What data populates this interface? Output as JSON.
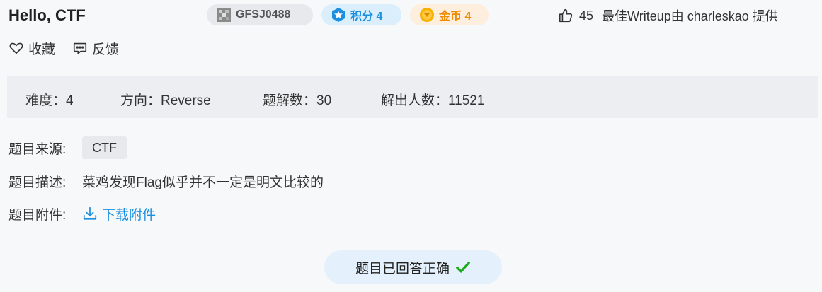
{
  "challenge": {
    "title": "Hello, CTF",
    "code": "GFSJ0488",
    "score_label": "积分 4",
    "coin_label": "金币 4"
  },
  "writeup": {
    "likes": "45",
    "text": "最佳Writeup由 charleskao 提供"
  },
  "actions": {
    "favorite": "收藏",
    "feedback": "反馈"
  },
  "stats": {
    "difficulty": "难度：4",
    "direction": "方向：Reverse",
    "solves": "题解数：30",
    "solvers": "解出人数：11521"
  },
  "details": {
    "source_label": "题目来源:",
    "source_value": "CTF",
    "desc_label": "题目描述:",
    "desc_value": "菜鸡发现Flag似乎并不一定是明文比较的",
    "attach_label": "题目附件:",
    "attach_link": "下载附件"
  },
  "status": {
    "answered": "题目已回答正确"
  },
  "colors": {
    "accent_blue": "#1d8fe0",
    "coin_orange": "#f08a00",
    "success_green": "#1aad19"
  }
}
